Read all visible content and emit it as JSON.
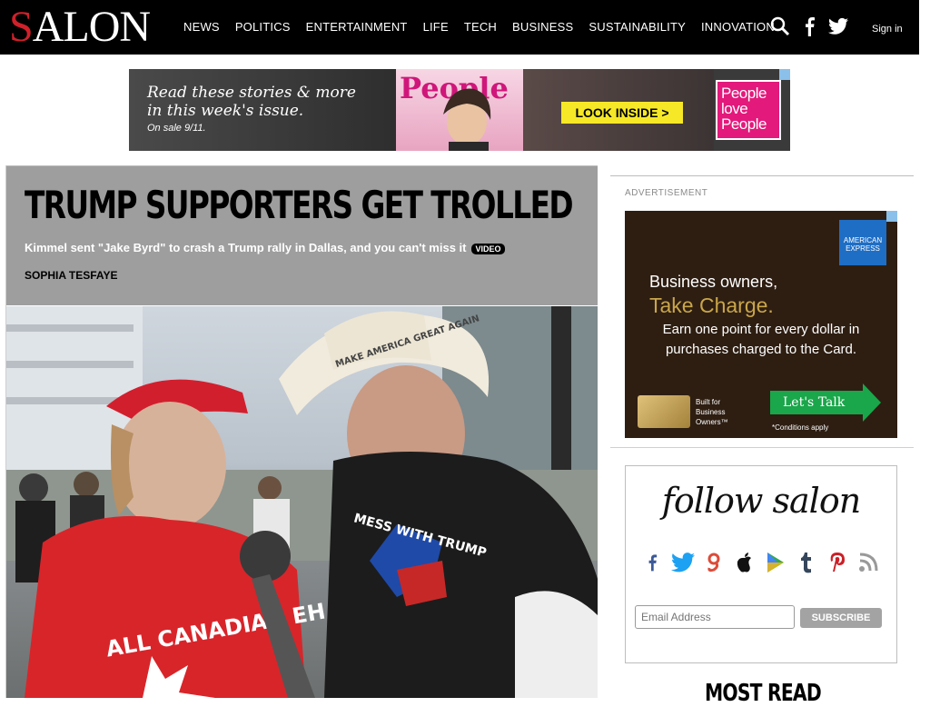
{
  "header": {
    "logo_s": "S",
    "logo_rest": "ALON",
    "nav": [
      "NEWS",
      "POLITICS",
      "ENTERTAINMENT",
      "LIFE",
      "TECH",
      "BUSINESS",
      "SUSTAINABILITY",
      "INNOVATION"
    ],
    "icons": [
      "search-icon",
      "facebook-icon",
      "twitter-icon"
    ],
    "signin": "Sign in",
    "colors": {
      "bar": "#000000",
      "logo_accent": "#d0202a"
    }
  },
  "banner_ad": {
    "headline_line1": "Read these stories & more",
    "headline_line2": "in this week's issue.",
    "onsale": "On sale 9/11.",
    "magazine": "People",
    "cta": "LOOK INSIDE >",
    "tag_line1": "People",
    "tag_line2": "love",
    "tag_line3": "People",
    "colors": {
      "cta": "#f6e826",
      "brand": "#e3197b"
    }
  },
  "article": {
    "title": "TRUMP SUPPORTERS GET TROLLED",
    "subtitle": "Kimmel sent \"Jake Byrd\" to crash a Trump rally in Dallas, and you can't miss it",
    "badge": "VIDEO",
    "author": "SOPHIA TESFAYE",
    "photo_hat_text": "MAKE AMERICA GREAT AGAIN",
    "photo_shirt_left": "ALL CANADIAN EH !",
    "photo_shirt_right": "MESS WITH TRUMP"
  },
  "sidebar_ad": {
    "label": "ADVERTISEMENT",
    "logo_text_line1": "AMERICAN",
    "logo_text_line2": "EXPRESS",
    "line1": "Business owners,",
    "line2": "Take Charge.",
    "line3": "Earn one point for every dollar in",
    "line4": "purchases charged to the Card.",
    "built_line1": "Built for",
    "built_line2": "Business",
    "built_line3": "Owners™",
    "cta": "Let's Talk",
    "conditions": "*Conditions apply",
    "colors": {
      "bg": "#2e1e12",
      "gold": "#c9a64a",
      "cta": "#1aa64a",
      "logo": "#1f6ec5"
    }
  },
  "follow": {
    "title": "follow salon",
    "social": [
      "facebook-icon",
      "twitter-icon",
      "google-plus-icon",
      "apple-icon",
      "google-play-icon",
      "tumblr-icon",
      "pinterest-icon",
      "rss-icon"
    ],
    "email_placeholder": "Email Address",
    "subscribe": "SUBSCRIBE"
  },
  "most_read": {
    "title": "MOST READ"
  }
}
